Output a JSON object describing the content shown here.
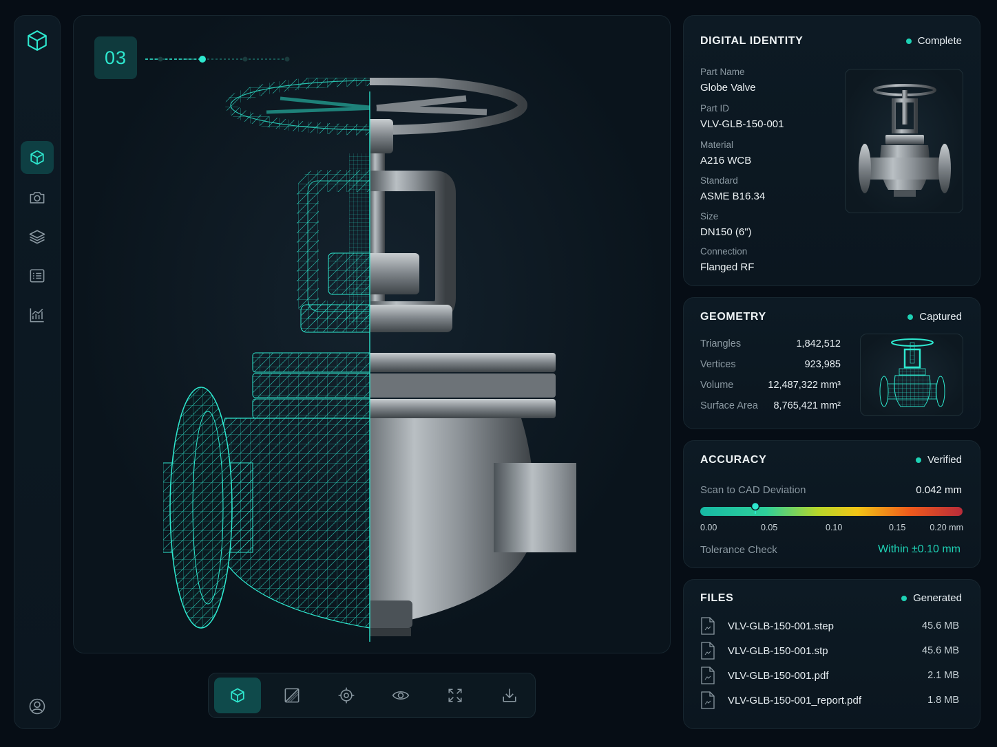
{
  "viewer": {
    "step": "03",
    "progress_current": 2,
    "progress_total": 4
  },
  "sidebar": {
    "items": [
      {
        "icon": "cube-icon",
        "active": true
      },
      {
        "icon": "camera-icon",
        "active": false
      },
      {
        "icon": "layers-icon",
        "active": false
      },
      {
        "icon": "list-icon",
        "active": false
      },
      {
        "icon": "chart-icon",
        "active": false
      }
    ],
    "user_icon": "user-icon"
  },
  "toolbar": {
    "tools": [
      "cube-icon",
      "section-icon",
      "target-icon",
      "eye-icon",
      "fullscreen-icon",
      "download-icon"
    ],
    "active": 0
  },
  "identity": {
    "title": "DIGITAL IDENTITY",
    "status": "Complete",
    "fields": [
      {
        "label": "Part Name",
        "value": "Globe Valve"
      },
      {
        "label": "Part ID",
        "value": "VLV-GLB-150-001"
      },
      {
        "label": "Material",
        "value": "A216 WCB"
      },
      {
        "label": "Standard",
        "value": "ASME B16.34"
      },
      {
        "label": "Size",
        "value": "DN150 (6\")"
      },
      {
        "label": "Connection",
        "value": "Flanged RF"
      }
    ]
  },
  "geometry": {
    "title": "GEOMETRY",
    "status": "Captured",
    "rows": [
      {
        "label": "Triangles",
        "value": "1,842,512"
      },
      {
        "label": "Vertices",
        "value": "923,985"
      },
      {
        "label": "Volume",
        "value": "12,487,322 mm³"
      },
      {
        "label": "Surface Area",
        "value": "8,765,421 mm²"
      }
    ]
  },
  "accuracy": {
    "title": "ACCURACY",
    "status": "Verified",
    "deviation_label": "Scan to CAD Deviation",
    "deviation_value": "0.042 mm",
    "deviation": 0.042,
    "scale_max": 0.2,
    "ticks": [
      "0.00",
      "0.05",
      "0.10",
      "0.15",
      "0.20 mm"
    ],
    "tolerance_label": "Tolerance Check",
    "tolerance_value": "Within ±0.10 mm",
    "accent": "#1ed1b4"
  },
  "files": {
    "title": "FILES",
    "status": "Generated",
    "items": [
      {
        "name": "VLV-GLB-150-001.step",
        "size": "45.6 MB"
      },
      {
        "name": "VLV-GLB-150-001.stp",
        "size": "45.6 MB"
      },
      {
        "name": "VLV-GLB-150-001.pdf",
        "size": "2.1 MB"
      },
      {
        "name": "VLV-GLB-150-001_report.pdf",
        "size": "1.8 MB"
      }
    ]
  }
}
